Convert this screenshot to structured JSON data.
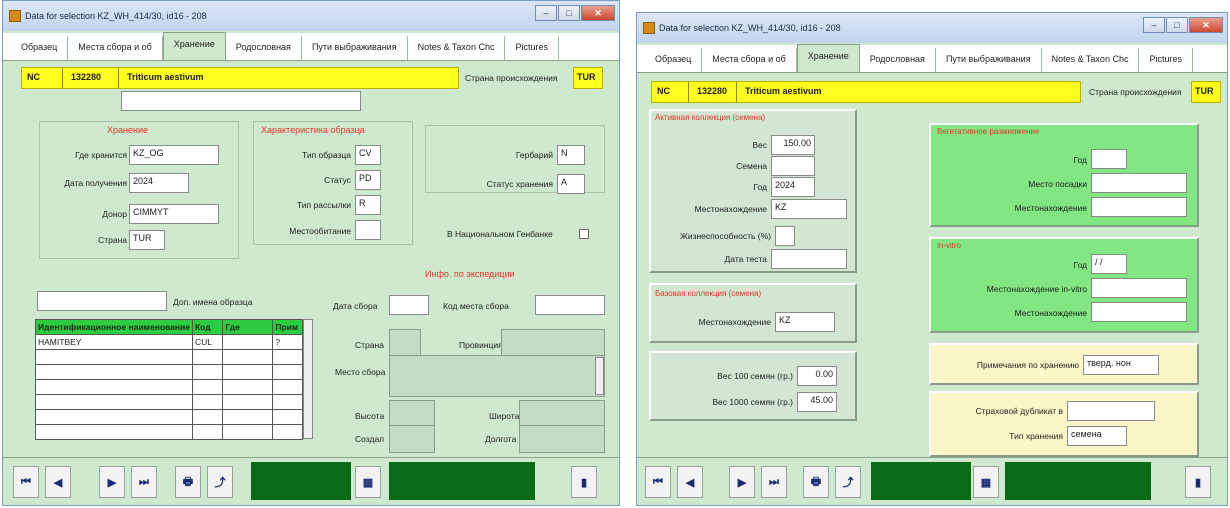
{
  "win1": {
    "title": "Data for selection KZ_WH_414/30, id16 - 208",
    "tabs": [
      "Образец",
      "Места сбора и об",
      "Хранение",
      "Родословная",
      "Пути выбраживания",
      "Notes & Taxon Chc",
      "Pictures"
    ],
    "active_tab": 2,
    "header": {
      "code": "NC",
      "number": "132280",
      "taxon": "Triticum aestivum",
      "country_label": "Страна происхождения",
      "country": "TUR"
    },
    "storage": {
      "title": "Хранение",
      "where_label": "Где хранится",
      "where": "KZ_OG",
      "date_label": "Дата получения",
      "date": "2024",
      "donor_label": "Донор",
      "donor": "CIMMYT",
      "country_label": "Страна",
      "country": "TUR"
    },
    "sample": {
      "title": "Характеристика образца",
      "type_label": "Тип образца",
      "type": "CV",
      "status_label": "Статус",
      "status": "PD",
      "distribution_label": "Тип рассылки",
      "distribution": "R",
      "location_label": "Местообитание",
      "location": ""
    },
    "herbarium_label": "Гербарий",
    "herbarium": "N",
    "storage_status_label": "Статус хранения",
    "storage_status": "A",
    "national_genebank_label": "В Национальном Генбанке",
    "search_label": "Доп. имена образца",
    "table": {
      "columns": [
        "Идентификационное наименование",
        "Код",
        "Где",
        "Прим"
      ],
      "rows": [
        [
          "HAMITBEY",
          "CUL",
          "",
          "?"
        ]
      ]
    },
    "expedition": {
      "title": "Инфо. по экспедиции",
      "collect_date_label": "Дата сбора",
      "collect_place_code_label": "Код места сбора",
      "country_label": "Страна",
      "province_label": "Провинция",
      "place_label": "Место сбора",
      "altitude_label": "Высота",
      "latitude_label": "Широта",
      "source_label": "Создал",
      "longitude_label": "Долгота"
    }
  },
  "win2": {
    "title": "Data for selection KZ_WH_414/30, id16 - 208",
    "tabs": [
      "Образец",
      "Места сбора и об",
      "Хранение",
      "Родословная",
      "Пути выбраживания",
      "Notes & Taxon Chc",
      "Pictures"
    ],
    "active_tab": 2,
    "header": {
      "code": "NC",
      "number": "132280",
      "taxon": "Triticum aestivum",
      "country_label": "Страна происхождения",
      "country": "TUR"
    },
    "active_collection": {
      "title": "Активная коллекция (семена)",
      "weight_label": "Вес",
      "weight": "150.00",
      "seeds_label": "Семена",
      "seeds": "",
      "year_label": "Год",
      "year": "2024",
      "location_label": "Местонахождение",
      "location": "KZ",
      "viability_label": "Жизнеспособность (%)",
      "viability": "",
      "test_date_label": "Дата теста",
      "test_date": ""
    },
    "base_collection": {
      "title": "Базовая коллекция (семена)",
      "location_label": "Местонахождение",
      "location": "KZ"
    },
    "weights": {
      "w100_label": "Вес 100 семян (гр.)",
      "w100": "0.00",
      "w1000_label": "Вес 1000 семян (гр.)",
      "w1000": "45.00"
    },
    "vegetative": {
      "title": "Вегетативное размножение",
      "year_label": "Год",
      "place_label": "Место посадки",
      "location_label": "Местонахождение"
    },
    "invitro": {
      "title": "in-vitro",
      "year_label": "Год",
      "year": "/ /",
      "location1_label": "Местонахождение in-vitro",
      "location2_label": "Местонахождение"
    },
    "notes_label": "Примечания по хранению",
    "notes": "тверд. нон",
    "safety_label": "Страховой дубликат в",
    "safety": "",
    "storage_type_label": "Тип хранения",
    "storage_type": "семена"
  },
  "nav": {
    "first": "⏮",
    "prev": "◀",
    "next": "▶",
    "last": "⏭",
    "print": "🖶",
    "exit": "⤴"
  }
}
